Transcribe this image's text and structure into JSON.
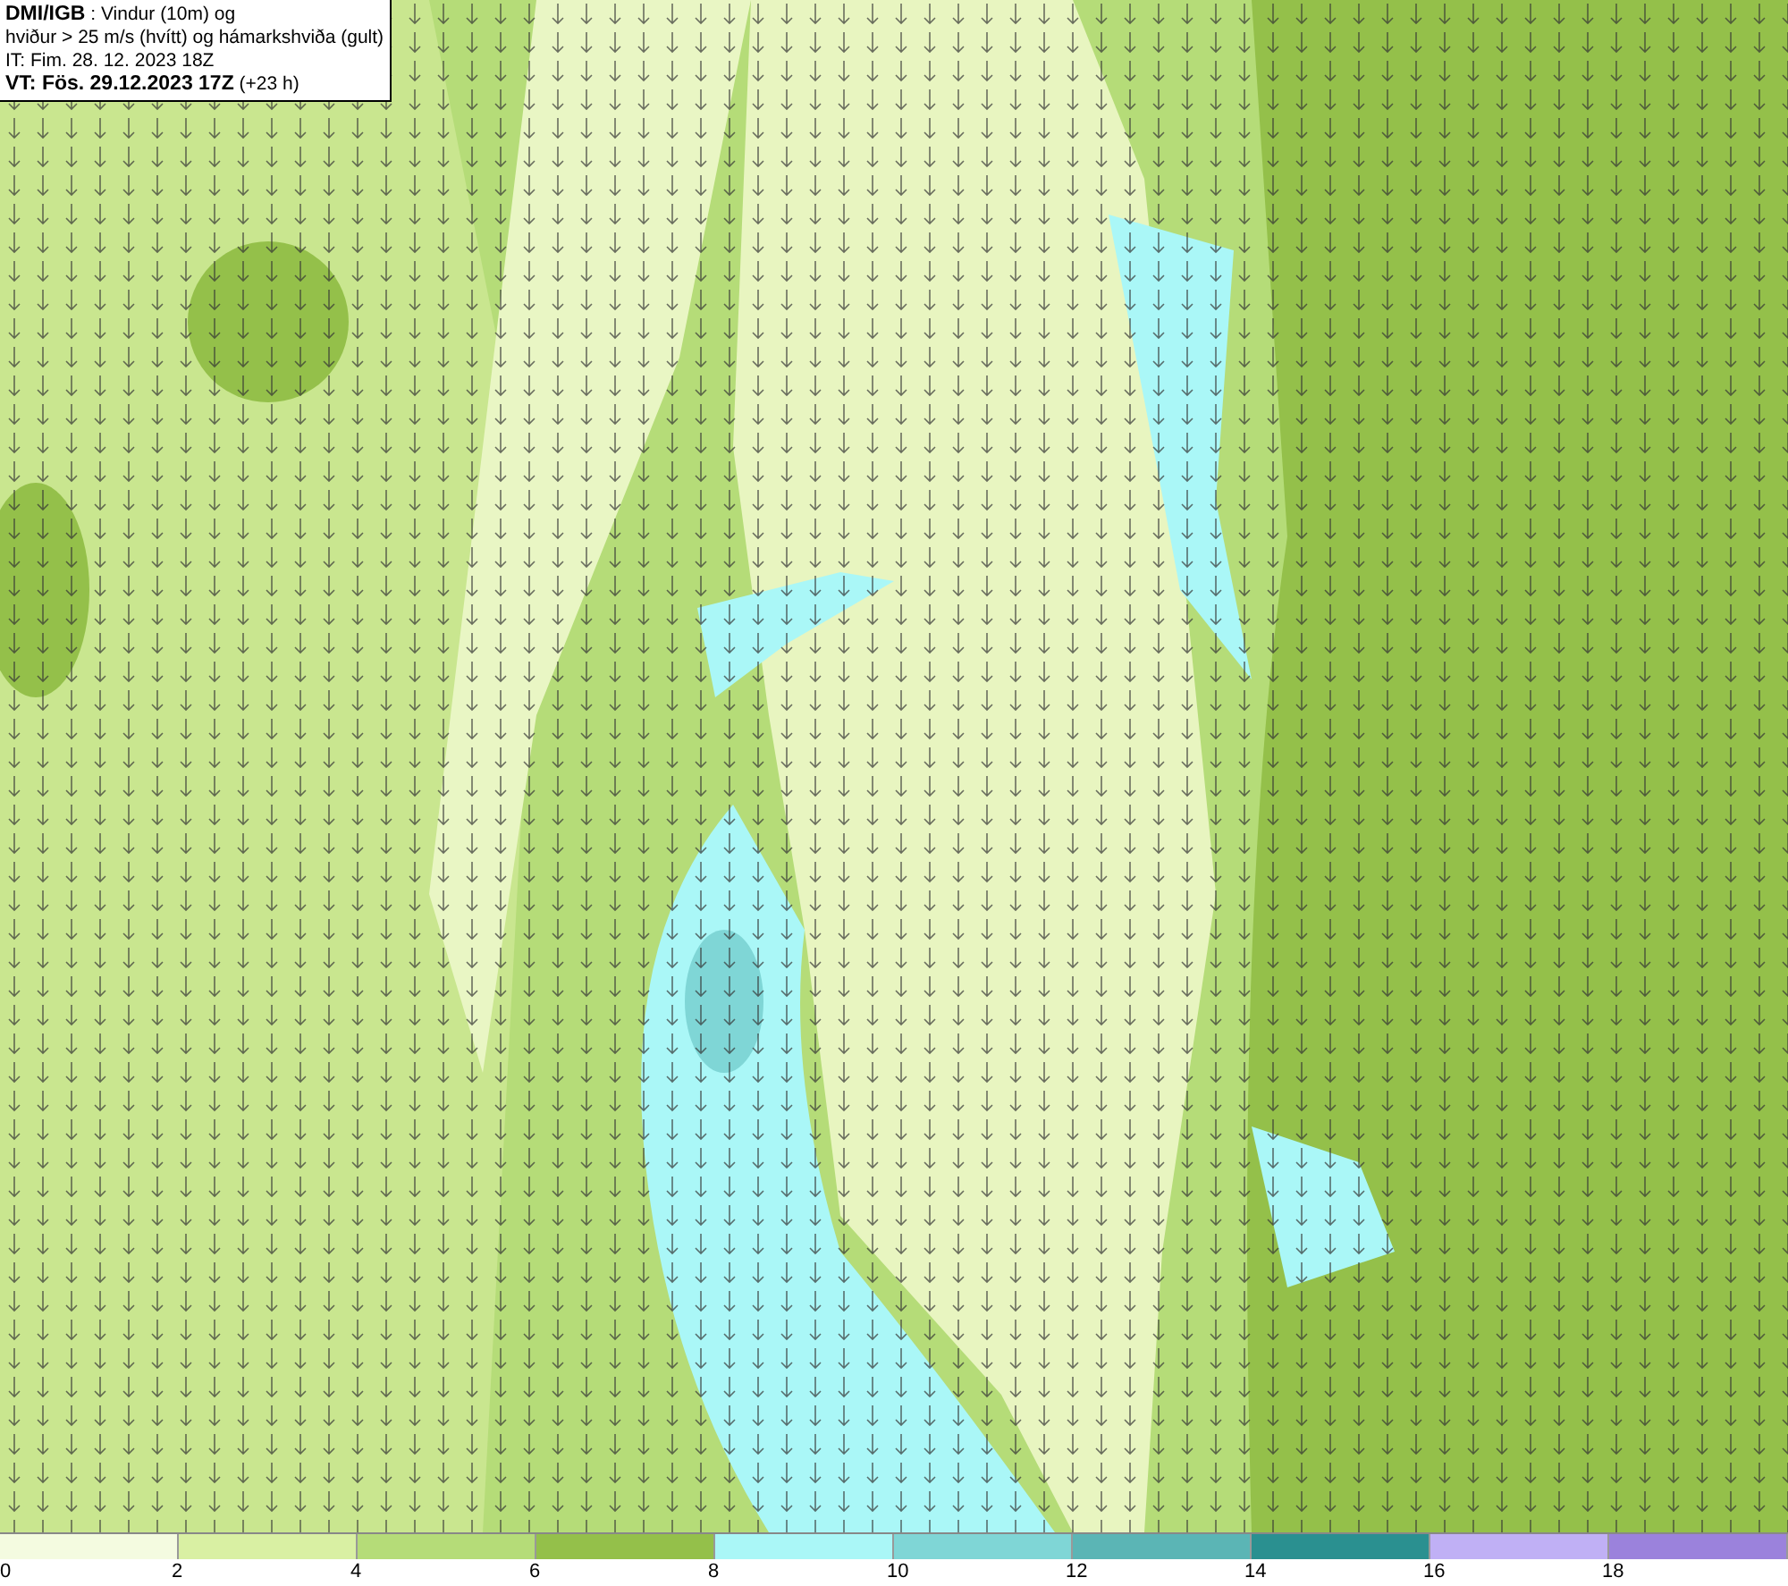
{
  "header": {
    "lines": [
      "**DMI/IGB** : Vindur (10m) og",
      "hviður > 25 m/s (hvítt) og hámarkshviða (gult)",
      "IT: Fim. 28. 12. 2023 18Z",
      "**VT: Fös. 29.12.2023 17Z** (+23 h)"
    ]
  },
  "legend": {
    "bins": [
      {
        "color": "#f4fbe0"
      },
      {
        "color": "#d9f0a3"
      },
      {
        "color": "#b5dc78"
      },
      {
        "color": "#94c04a"
      },
      {
        "color": "#aaf7f7"
      },
      {
        "color": "#7fd6d6"
      },
      {
        "color": "#5bb5b5"
      },
      {
        "color": "#2a9090"
      },
      {
        "color": "#c0b0f5"
      },
      {
        "color": "#9b82dc"
      }
    ],
    "ticks": [
      "0",
      "2",
      "4",
      "6",
      "8",
      "10",
      "12",
      "14",
      "16",
      "18"
    ]
  }
}
